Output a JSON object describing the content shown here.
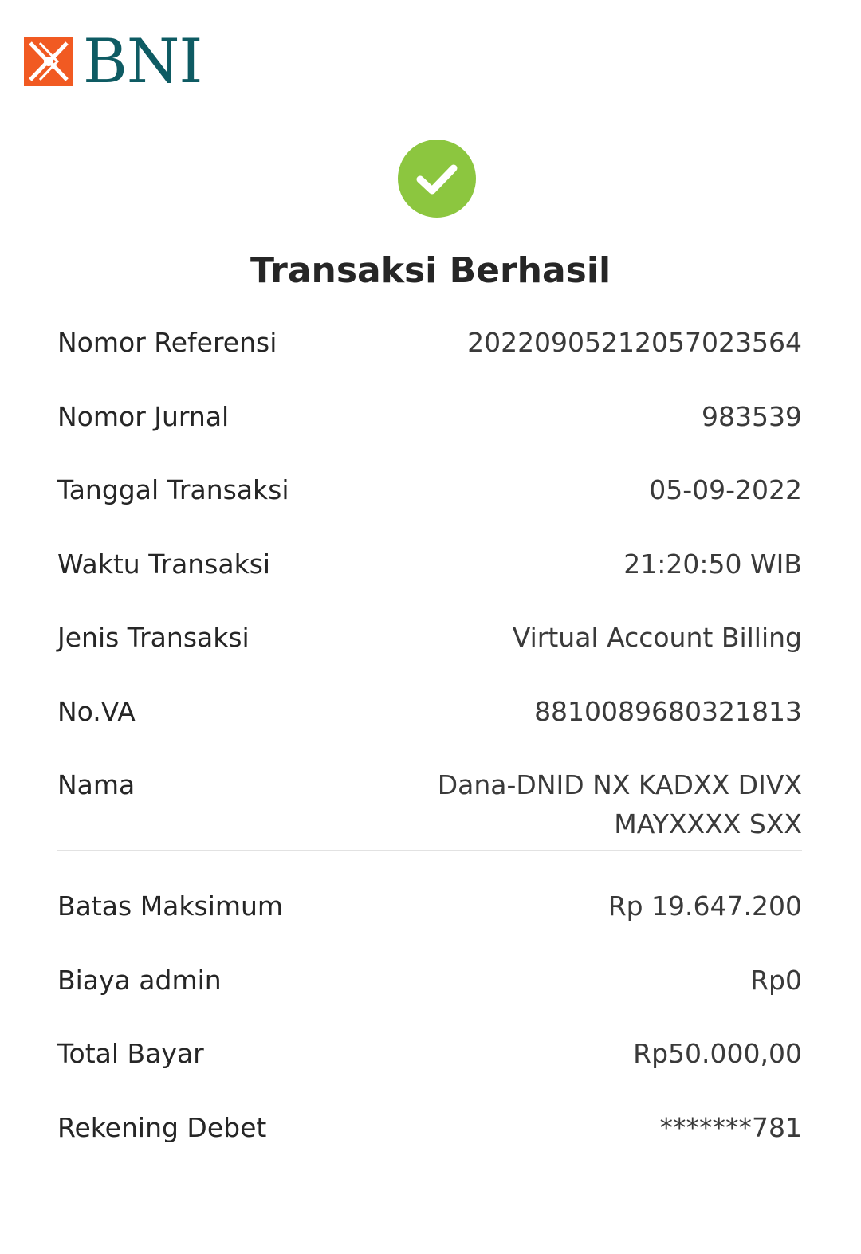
{
  "brand": {
    "name": "BNI",
    "mark_color": "#f15a22",
    "text_color": "#0e5b63"
  },
  "status": {
    "icon": "check-circle-icon",
    "color": "#8cc63f",
    "title": "Transaksi Berhasil"
  },
  "details": [
    {
      "label": "Nomor Referensi",
      "value": "20220905212057023564"
    },
    {
      "label": "Nomor Jurnal",
      "value": "983539"
    },
    {
      "label": "Tanggal Transaksi",
      "value": "05-09-2022"
    },
    {
      "label": "Waktu Transaksi",
      "value": "21:20:50 WIB"
    },
    {
      "label": "Jenis Transaksi",
      "value": "Virtual Account Billing"
    },
    {
      "label": "No.VA",
      "value": "8810089680321813"
    },
    {
      "label": "Nama",
      "value": "Dana-DNID NX KADXX DIVX MAYXXXX SXX"
    }
  ],
  "payment": [
    {
      "label": "Batas Maksimum",
      "value": "Rp 19.647.200"
    },
    {
      "label": "Biaya admin",
      "value": "Rp0"
    },
    {
      "label": "Total Bayar",
      "value": "Rp50.000,00"
    },
    {
      "label": "Rekening Debet",
      "value": "*******781"
    }
  ]
}
